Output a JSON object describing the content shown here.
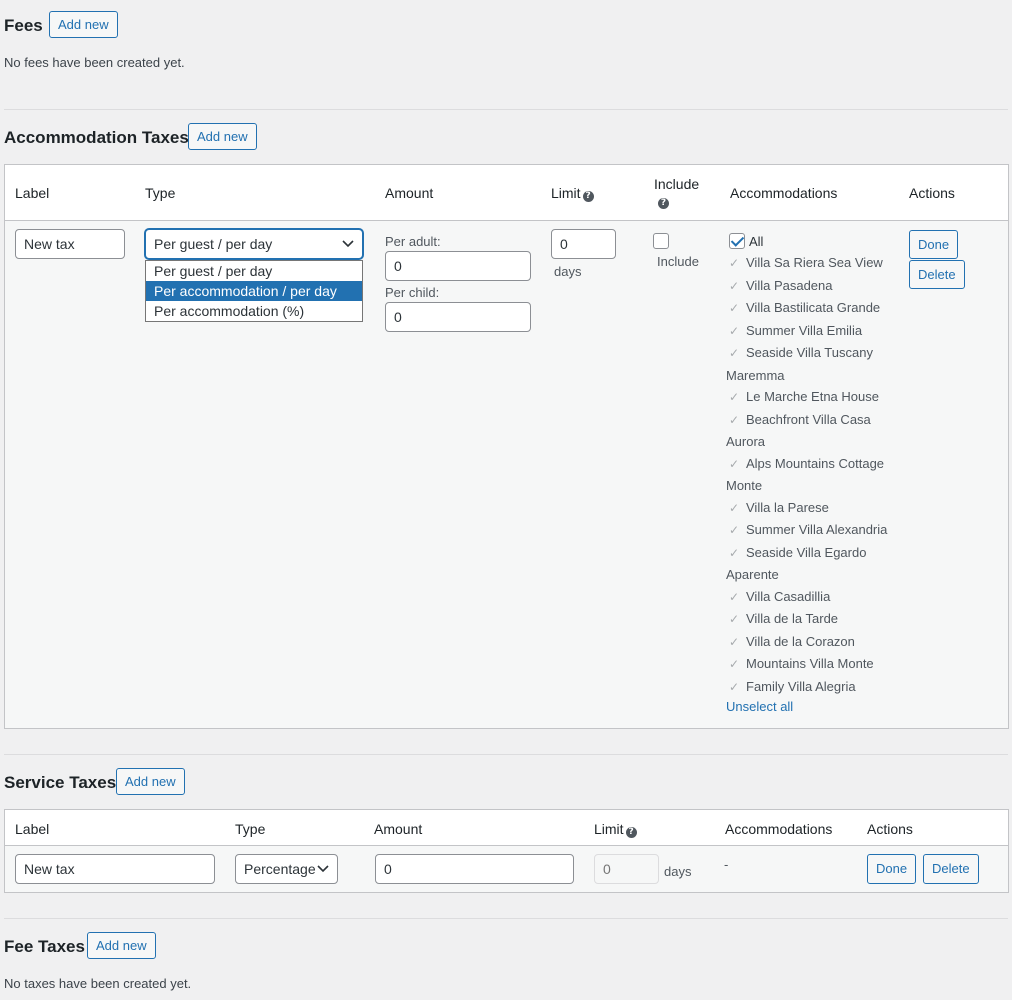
{
  "fees": {
    "title": "Fees",
    "add_new": "Add new",
    "empty": "No fees have been created yet."
  },
  "accommodation_taxes": {
    "title": "Accommodation Taxes",
    "add_new": "Add new",
    "headers": {
      "label": "Label",
      "type": "Type",
      "amount": "Amount",
      "limit": "Limit",
      "include": "Include",
      "accommodations": "Accommodations",
      "actions": "Actions"
    },
    "row": {
      "label_value": "New tax",
      "type_selected": "Per guest / per day",
      "type_options": [
        "Per guest / per day",
        "Per accommodation / per day",
        "Per accommodation (%)"
      ],
      "type_highlighted": "Per accommodation / per day",
      "per_adult_label": "Per adult:",
      "per_adult_value": "0",
      "per_child_label": "Per child:",
      "per_child_value": "0",
      "limit_value": "0",
      "limit_unit": "days",
      "include_label": "Include",
      "include_checked": false,
      "all_label": "All",
      "all_checked": true,
      "accommodations": [
        "Villa Sa Riera Sea View",
        "Villa Pasadena",
        "Villa Bastilicata Grande",
        "Summer Villa Emilia",
        "Seaside Villa Tuscany Maremma",
        "Le Marche Etna House",
        "Beachfront Villa Casa Aurora",
        "Alps Mountains Cottage Monte",
        "Villa la Parese",
        "Summer Villa Alexandria",
        "Seaside Villa Egardo Aparente",
        "Villa Casadillia",
        "Villa de la Tarde",
        "Villa de la Corazon",
        "Mountains Villa Monte",
        "Family Villa Alegria"
      ],
      "unselect_all": "Unselect all",
      "done": "Done",
      "delete": "Delete"
    }
  },
  "service_taxes": {
    "title": "Service Taxes",
    "add_new": "Add new",
    "headers": {
      "label": "Label",
      "type": "Type",
      "amount": "Amount",
      "limit": "Limit",
      "accommodations": "Accommodations",
      "actions": "Actions"
    },
    "row": {
      "label_value": "New tax",
      "type_selected": "Percentage",
      "amount_value": "0",
      "limit_placeholder": "0",
      "limit_unit": "days",
      "accommodations_value": "-",
      "done": "Done",
      "delete": "Delete"
    }
  },
  "fee_taxes": {
    "title": "Fee Taxes",
    "add_new": "Add new",
    "empty": "No taxes have been created yet."
  },
  "icons": {
    "help": "question-circle-icon",
    "chevron": "chevron-down-icon",
    "check": "checkmark-icon"
  },
  "colors": {
    "accent": "#2271b1",
    "background": "#f0f0f1",
    "highlight": "#2271b1"
  }
}
